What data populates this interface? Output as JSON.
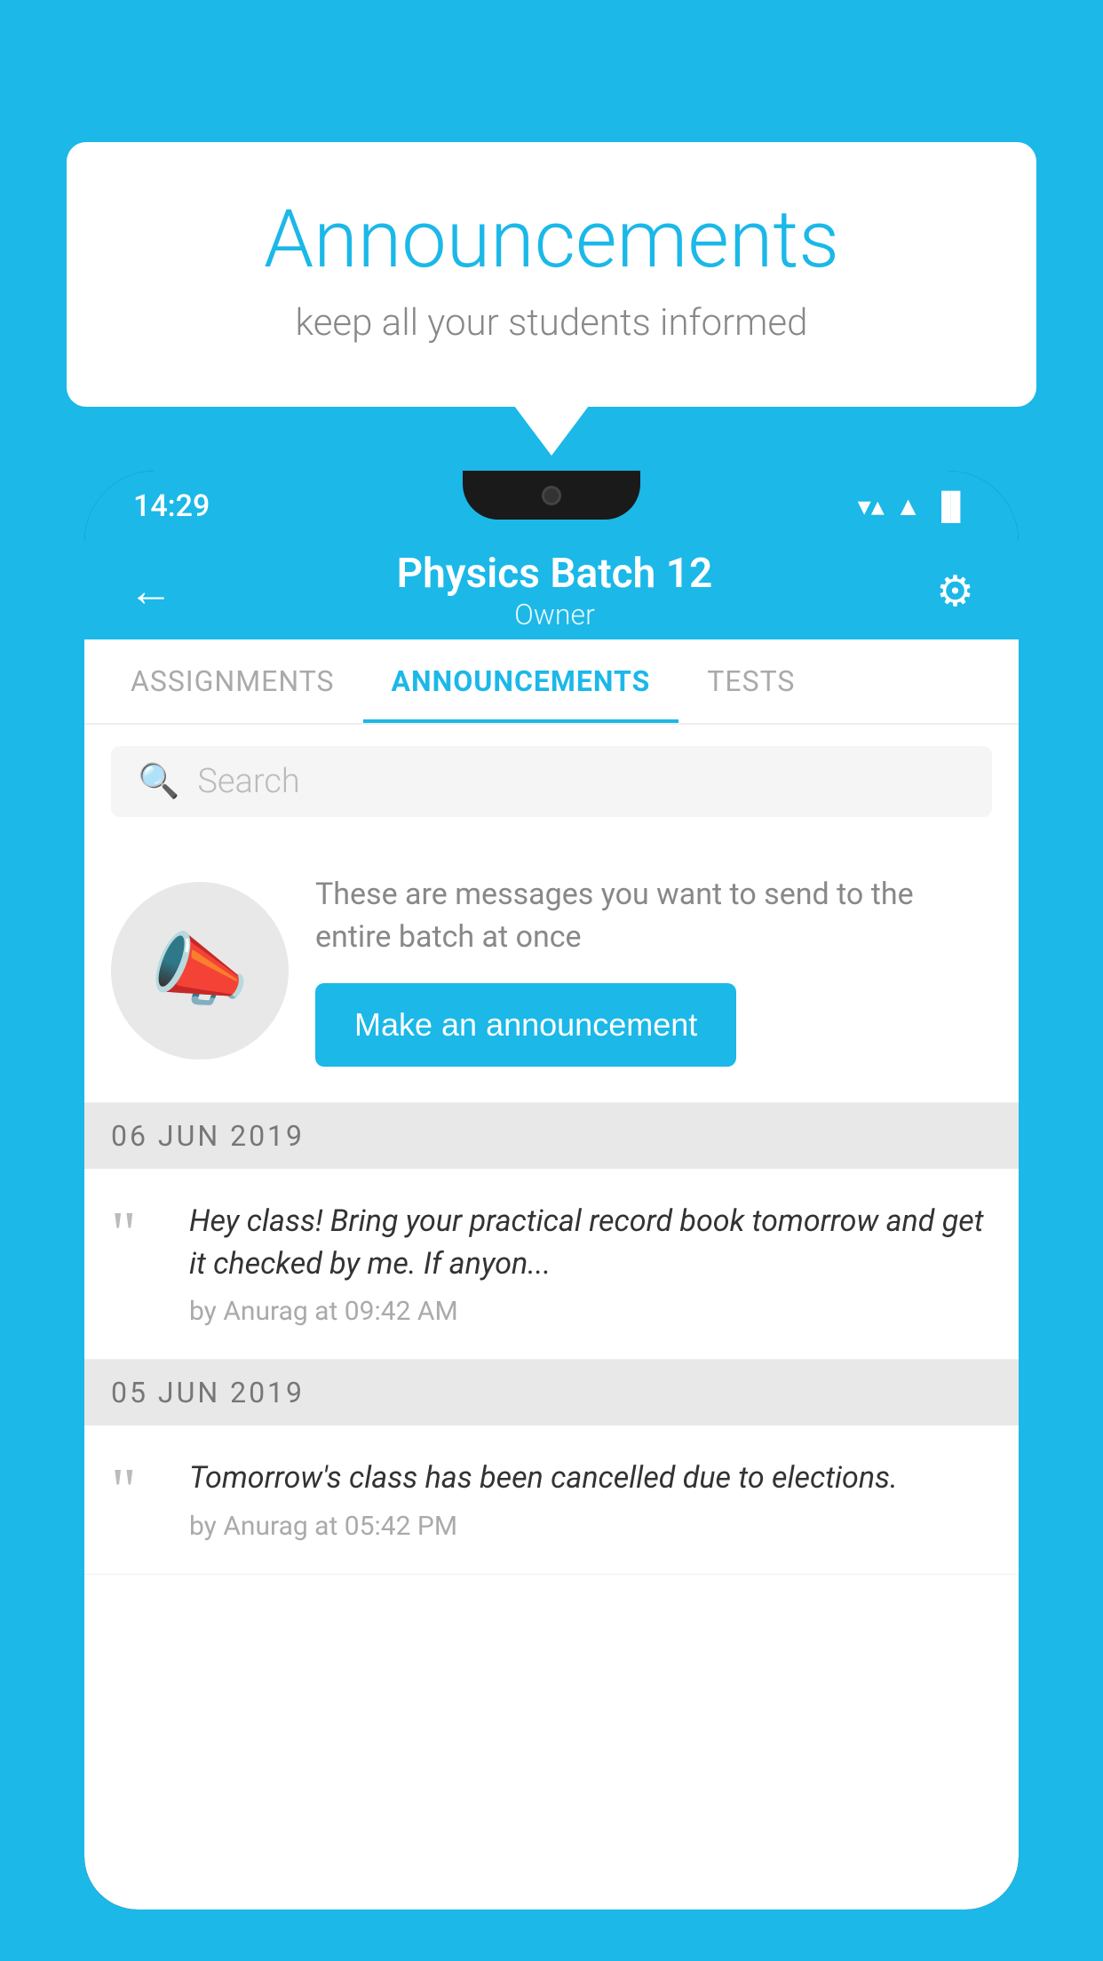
{
  "background_color": "#1BB8E8",
  "speech_bubble": {
    "title": "Announcements",
    "subtitle": "keep all your students informed"
  },
  "phone": {
    "status_bar": {
      "time": "14:29",
      "wifi": "▼",
      "signal": "▲",
      "battery": "▐"
    },
    "header": {
      "title": "Physics Batch 12",
      "subtitle": "Owner",
      "back_label": "←",
      "settings_label": "⚙"
    },
    "tabs": [
      {
        "label": "ASSIGNMENTS",
        "active": false
      },
      {
        "label": "ANNOUNCEMENTS",
        "active": true
      },
      {
        "label": "TESTS",
        "active": false
      }
    ],
    "search": {
      "placeholder": "Search"
    },
    "promo": {
      "description": "These are messages you want to send to the entire batch at once",
      "button_label": "Make an announcement"
    },
    "announcements": [
      {
        "date": "06  JUN  2019",
        "text": "Hey class! Bring your practical record book tomorrow and get it checked by me. If anyon...",
        "meta": "by Anurag at 09:42 AM"
      },
      {
        "date": "05  JUN  2019",
        "text": "Tomorrow's class has been cancelled due to elections.",
        "meta": "by Anurag at 05:42 PM"
      }
    ]
  }
}
